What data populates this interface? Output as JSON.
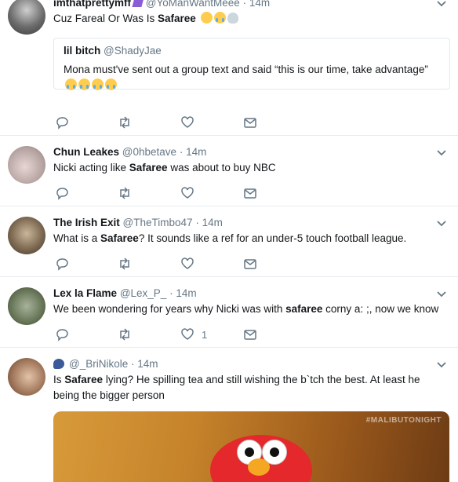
{
  "tweets": [
    {
      "name": "imthatprettymff",
      "handle": "@YoManWantMeee",
      "dot": "·",
      "time": "14m",
      "text_pre": "Cuz Fareal Or Was Is ",
      "text_bold": "Safaree",
      "text_post": "",
      "quote": {
        "name": "lil bitch",
        "handle": "@ShadyJae",
        "text": "Mona must've sent out a group text and said “this is our time, take advantage”"
      }
    },
    {
      "name": "Chun Leakes",
      "handle": "@0hbetave",
      "dot": "·",
      "time": "14m",
      "text_pre": "Nicki acting like ",
      "text_bold": "Safaree",
      "text_post": " was about to buy NBC"
    },
    {
      "name": "The Irish Exit",
      "handle": "@TheTimbo47",
      "dot": "·",
      "time": "14m",
      "text_pre": "What is a ",
      "text_bold": "Safaree",
      "text_post": "? It sounds like a ref for an under-5 touch football league."
    },
    {
      "name": "Lex la Flame",
      "handle": "@Lex_P_",
      "dot": "·",
      "time": "14m",
      "text_pre": "We been wondering for years why Nicki was with ",
      "text_bold": "safaree",
      "text_post": " corny a: ;, now we know",
      "like_count": "1"
    },
    {
      "name": "",
      "handle": "@_BriNikole",
      "dot": "·",
      "time": "14m",
      "text_pre": "Is ",
      "text_bold": "Safaree",
      "text_post": " lying? He spilling tea and still wishing the b`tch the best. At least he being the bigger person",
      "media_watermark": "#MALIBUTONIGHT"
    }
  ],
  "colors": {
    "text": "#14171a",
    "secondary": "#657786",
    "border": "#e6ecf0",
    "icon": "#657786"
  },
  "icons": [
    "reply-icon",
    "retweet-icon",
    "like-icon",
    "dm-icon",
    "chevron-down-icon"
  ]
}
